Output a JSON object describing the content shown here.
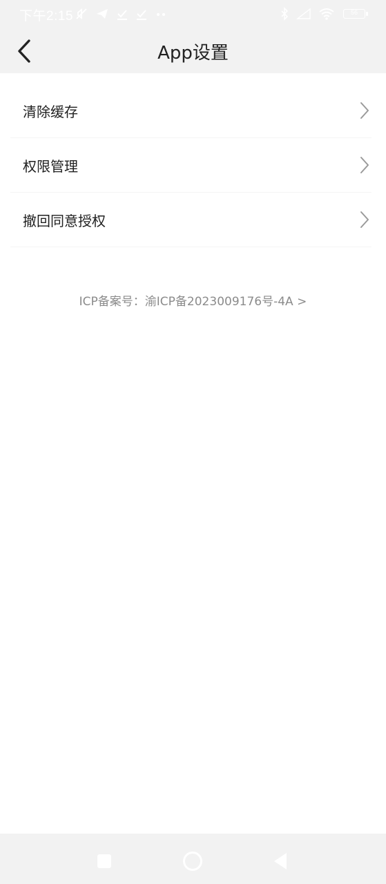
{
  "status_bar": {
    "time": "下午2:15",
    "left_icons": [
      "mute-icon",
      "telegram-icon",
      "task-check-icon",
      "task-check-icon",
      "more-dots-icon"
    ],
    "right_icons": [
      "bluetooth-icon",
      "signal-icon",
      "wifi-icon"
    ],
    "battery": "56"
  },
  "header": {
    "title": "App设置",
    "back_icon": "chevron-left-icon"
  },
  "menu": {
    "items": [
      {
        "label": "清除缓存"
      },
      {
        "label": "权限管理"
      },
      {
        "label": "撤回同意授权"
      }
    ]
  },
  "footer": {
    "icp": "ICP备案号：渝ICP备2023009176号-4A >"
  },
  "system_nav": {
    "buttons": [
      "recent-apps-square-icon",
      "home-circle-icon",
      "back-triangle-icon"
    ]
  },
  "colors": {
    "header_bg": "#f2f2f2",
    "page_bg": "#ffffff",
    "text_primary": "#1f1f1f",
    "text_secondary": "#8b8b8b",
    "chevron": "#9a9a9a",
    "divider": "#f4f4f4"
  }
}
